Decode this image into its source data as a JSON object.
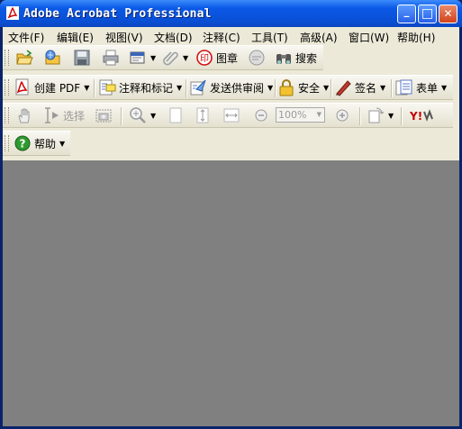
{
  "window": {
    "title": "Adobe Acrobat Professional",
    "minimize_glyph": "_",
    "maximize_glyph": "□",
    "close_glyph": "✕"
  },
  "menu": [
    {
      "label": "文件(F)"
    },
    {
      "label": "编辑(E)"
    },
    {
      "label": "视图(V)"
    },
    {
      "label": "文档(D)"
    },
    {
      "label": "注释(C)"
    },
    {
      "label": "工具(T)"
    },
    {
      "label": "高级(A)"
    },
    {
      "label": "窗口(W)"
    },
    {
      "label": "帮助(H)"
    }
  ],
  "toolbar1": {
    "stamp_label": "图章",
    "search_label": "搜索"
  },
  "toolbar2": {
    "create_pdf": "创建 PDF",
    "comment_markup": "注释和标记",
    "send_review": "发送供审阅",
    "security": "安全",
    "sign": "签名",
    "forms": "表单"
  },
  "toolbar3": {
    "select_label": "选择",
    "zoom_value": "100%"
  },
  "toolbar4": {
    "help_label": "帮助"
  },
  "colors": {
    "doc_background": "#808080",
    "titlebar": "#0a4fd4",
    "chrome": "#ece9d8"
  },
  "icons": [
    "adobe-pdf-icon",
    "open-icon",
    "open-web-icon",
    "save-icon",
    "print-icon",
    "email-icon",
    "attach-icon",
    "stamp-icon",
    "review-icon",
    "search-binoculars-icon",
    "create-pdf-icon",
    "comment-icon",
    "send-review-icon",
    "lock-icon",
    "pen-icon",
    "forms-icon",
    "hand-icon",
    "select-text-icon",
    "snapshot-icon",
    "zoom-in-icon",
    "page-icon",
    "fit-page-icon",
    "fit-width-icon",
    "zoom-out-minus-icon",
    "zoom-in-plus-icon",
    "rotate-icon",
    "yahoo-icon",
    "help-icon"
  ]
}
